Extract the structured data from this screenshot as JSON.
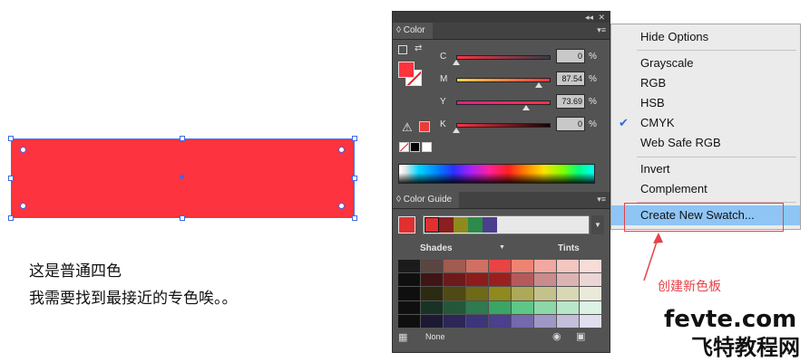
{
  "note": {
    "line1": "这是普通四色",
    "line2": "我需要找到最接近的专色唉。。"
  },
  "fill_color": "#fd3340",
  "color_panel": {
    "tab_label": "Color",
    "sliders": [
      {
        "label": "C",
        "value": "0",
        "fraction": 0.0
      },
      {
        "label": "M",
        "value": "87.54",
        "fraction": 0.8754
      },
      {
        "label": "Y",
        "value": "73.69",
        "fraction": 0.7369
      },
      {
        "label": "K",
        "value": "0",
        "fraction": 0.0
      }
    ],
    "percent_sign": "%"
  },
  "color_guide": {
    "tab_label": "Color Guide",
    "shades_label": "Shades",
    "tints_label": "Tints",
    "none_label": "None",
    "harmony_colors": [
      "#e03030",
      "#8a1f1f",
      "#8e8a1c",
      "#2c8a4a",
      "#4b3f8e"
    ],
    "grid": [
      [
        "#1b1b1b",
        "#5a4541",
        "#a25b51",
        "#d07063",
        "#ea4343",
        "#ed8473",
        "#f0a8a0",
        "#f3c6c0",
        "#f7dcd8"
      ],
      [
        "#0f0f0f",
        "#3f1515",
        "#6d1a1a",
        "#8b1d1d",
        "#9a2020",
        "#b45a5a",
        "#c98c8c",
        "#dcb3b3",
        "#ecd5d5"
      ],
      [
        "#0f0f0f",
        "#2c2a10",
        "#4f4a14",
        "#6f6a18",
        "#8e8a1c",
        "#aca958",
        "#c4c28a",
        "#d9d8b5",
        "#eaeada"
      ],
      [
        "#0f0f0f",
        "#183326",
        "#24573a",
        "#2f7a50",
        "#3aa565",
        "#5ec687",
        "#8cd8a8",
        "#b8e6c8",
        "#dcf2e4"
      ],
      [
        "#0f0f0f",
        "#1c1a33",
        "#2c2756",
        "#3c357a",
        "#4b3f8e",
        "#7369ab",
        "#9f98c6",
        "#c3bedc",
        "#e0deef"
      ]
    ]
  },
  "context_menu": {
    "items": [
      {
        "label": "Hide Options",
        "checked": false
      },
      {
        "label": "Grayscale",
        "checked": false
      },
      {
        "label": "RGB",
        "checked": false
      },
      {
        "label": "HSB",
        "checked": false
      },
      {
        "label": "CMYK",
        "checked": true
      },
      {
        "label": "Web Safe RGB",
        "checked": false
      },
      {
        "label": "Invert",
        "checked": false
      },
      {
        "label": "Complement",
        "checked": false
      },
      {
        "label": "Create New Swatch...",
        "checked": false,
        "highlighted": true
      }
    ],
    "highlight_color": "#8fc5f4"
  },
  "annotation": {
    "text": "创建新色板",
    "color": "#e5434a"
  },
  "watermark": {
    "line1": "fevte.com",
    "line2": "飞特教程网"
  }
}
